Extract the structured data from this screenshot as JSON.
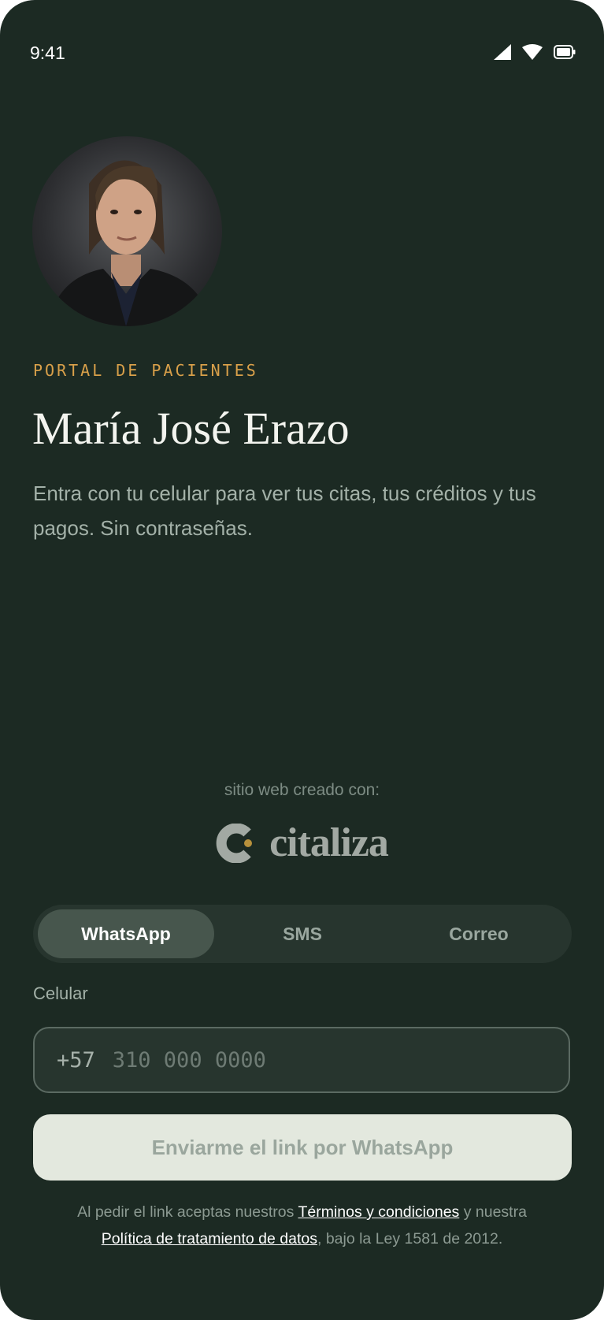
{
  "status_bar": {
    "time": "9:41",
    "icons": [
      "signal-icon",
      "wifi-icon",
      "battery-icon"
    ]
  },
  "profile": {
    "eyebrow": "PORTAL DE PACIENTES",
    "name": "María José Erazo",
    "description": "Entra con tu celular para ver tus citas, tus créditos y tus pagos. Sin contraseñas."
  },
  "credit": {
    "text": "sitio web creado con:",
    "brand": "citaliza",
    "logo_icon": "citaliza-logo-icon"
  },
  "tabs": [
    {
      "label": "WhatsApp",
      "active": true
    },
    {
      "label": "SMS",
      "active": false
    },
    {
      "label": "Correo",
      "active": false
    }
  ],
  "form": {
    "label": "Celular",
    "prefix": "+57",
    "value": "",
    "placeholder": "310 000 0000",
    "submit_label": "Enviarme el link por WhatsApp"
  },
  "legal": {
    "part1": "Al pedir el link aceptas nuestros ",
    "terms_link": "Términos y condiciones",
    "part2": " y nuestra ",
    "privacy_link": "Política de tratamiento de datos",
    "part3": ", bajo la Ley 1581 de 2012."
  },
  "colors": {
    "background": "#1c2a23",
    "accent": "#d9a04a",
    "active_tab": "#47564d",
    "button": "#e3e8de"
  }
}
